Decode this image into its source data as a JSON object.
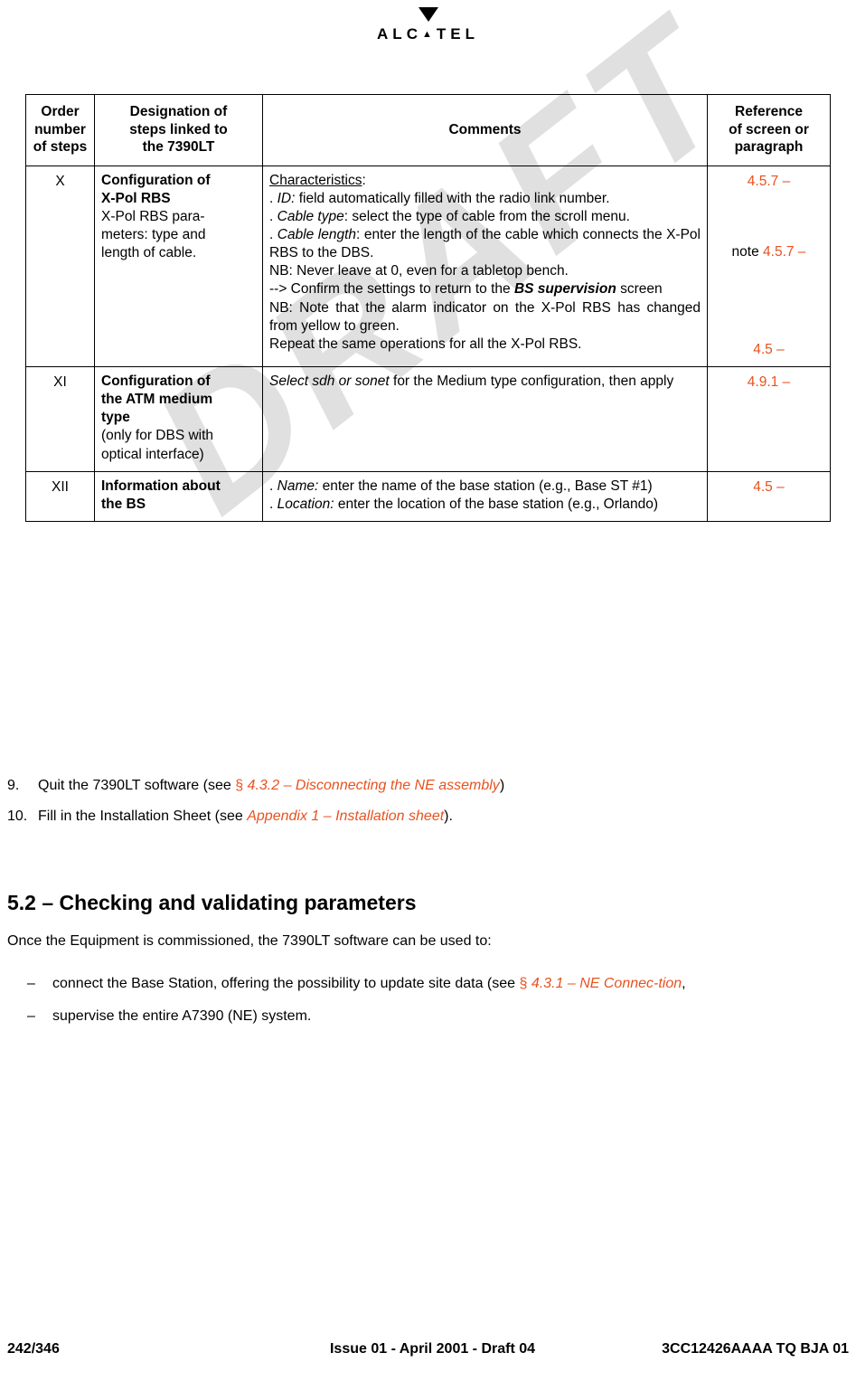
{
  "brand": {
    "name": "ALCATEL",
    "letters": [
      "A",
      "L",
      "C",
      "A",
      "T",
      "E",
      "L"
    ],
    "arrow_icon": "down-triangle-icon"
  },
  "table": {
    "headers": {
      "order": "Order\nnumber\nof steps",
      "order_l1": "Order",
      "order_l2": "number",
      "order_l3": "of steps",
      "designation_l1": "Designation of",
      "designation_l2": "steps linked to",
      "designation_l3": "the 7390LT",
      "comments": "Comments",
      "reference_l1": "Reference",
      "reference_l2": "of screen or",
      "reference_l3": "paragraph"
    },
    "rows": [
      {
        "order": "X",
        "designation_bold_l1": "Configuration of",
        "designation_bold_l2": "X-Pol RBS",
        "designation_rest": "X-Pol RBS para-meters: type and length of cable.",
        "designation_rest_l1": "X-Pol RBS para-",
        "designation_rest_l2": "meters: type and",
        "designation_rest_l3": "length of cable.",
        "comments": {
          "c1_label": "Characteristics",
          "c1_colon": ":",
          "c2_pre": ". ",
          "c2_italic": "ID:",
          "c2_post": " field automatically filled with the radio link number.",
          "c3_pre": ". ",
          "c3_italic": "Cable type",
          "c3_post": ": select the type of cable from the scroll menu.",
          "c4_pre": ". ",
          "c4_italic": "Cable length",
          "c4_post": ": enter the length of the cable which connects the X-Pol RBS to the DBS.",
          "c5": "NB: Never leave at 0, even for a tabletop bench.",
          "c6_pre": "--> Confirm the settings to return to the ",
          "c6_bolditalic": "BS supervision",
          "c6_post": " screen",
          "c7": "NB: Note that the alarm indicator on the X-Pol RBS has changed from yellow to green.",
          "c8": "Repeat the same operations for all the X-Pol RBS."
        },
        "reference_l1": "4.5.7 –",
        "reference_l2_prefix": "note ",
        "reference_l2": "4.5.7 –",
        "reference_l3": "4.5 –"
      },
      {
        "order": "XI",
        "designation_bold_l1": "Configuration of",
        "designation_bold_l2": "the ATM medium",
        "designation_bold_l3": "type",
        "designation_rest_l1": "(only for DBS with",
        "designation_rest_l2": "optical interface)",
        "comments": {
          "c1_pre": "",
          "c1_italic": "Select sdh or sonet",
          "c1_post": " for the Medium type configuration, then apply"
        },
        "reference_l1": "4.9.1 –"
      },
      {
        "order": "XII",
        "designation_bold_l1": "Information about",
        "designation_bold_l2": "the BS",
        "comments": {
          "c1_pre": ". ",
          "c1_italic": "Name:",
          "c1_post": " enter the name of the base station (e.g., Base ST #1)",
          "c2_pre": ". ",
          "c2_italic": "Location:",
          "c2_post": " enter the location of the base station (e.g., Orlando)"
        },
        "reference_l1": "4.5 –"
      }
    ]
  },
  "numbered_list": [
    {
      "num": "9.",
      "pre": "Quit the 7390LT software (see ",
      "ref_symbol": "§ ",
      "ref_italic": "4.3.2 – Disconnecting the NE assembly",
      "post": ")"
    },
    {
      "num": "10.",
      "pre": "Fill in the Installation Sheet (see ",
      "ref_symbol": "",
      "ref_italic": "Appendix 1 – Installation sheet",
      "post": ")."
    }
  ],
  "section": {
    "heading": "5.2 – Checking and validating parameters",
    "intro": "Once the Equipment is commissioned, the 7390LT software can be used to:",
    "bullets": [
      {
        "dash": "–",
        "pre": "connect the Base Station, offering the possibility to update site data (see ",
        "ref_symbol": "§ ",
        "ref_italic": "4.3.1 – NE Connec-tion",
        "ref_italic_l1": "4.3.1 – NE Connec-",
        "ref_italic_l2": "tion",
        "post": ","
      },
      {
        "dash": "–",
        "pre": "supervise the entire A7390 (NE) system.",
        "ref_symbol": "",
        "ref_italic": "",
        "post": ""
      }
    ]
  },
  "footer": {
    "page_number": "242",
    "page_total": "/346",
    "issue": "Issue 01 - April 2001 - Draft 04",
    "doc_code": "3CC12426AAAA TQ BJA 01"
  },
  "watermark": {
    "text": "DRAFT"
  },
  "colors": {
    "accent_orange": "#e8521f",
    "text": "#000000",
    "background": "#ffffff"
  }
}
